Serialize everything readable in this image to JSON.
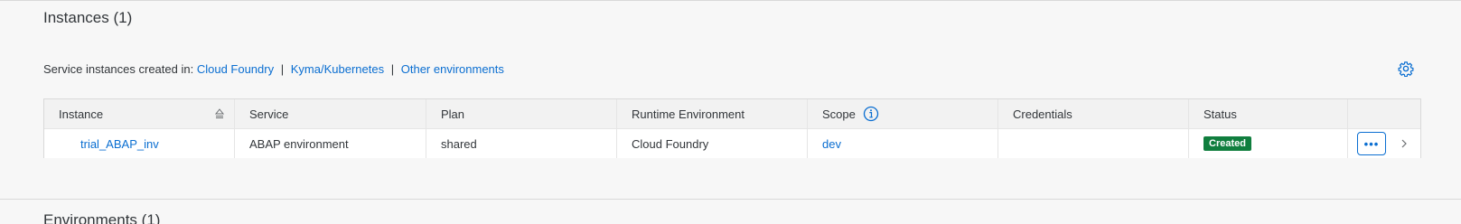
{
  "instances": {
    "title": "Instances (1)",
    "created_in_label": "Service instances created in:",
    "env_links": [
      "Cloud Foundry",
      "Kyma/Kubernetes",
      "Other environments"
    ],
    "separator": "|",
    "settings_icon": "gear-icon",
    "table": {
      "headers": [
        "Instance",
        "Service",
        "Plan",
        "Runtime Environment",
        "Scope",
        "Credentials",
        "Status",
        ""
      ],
      "rows": [
        {
          "instance": "trial_ABAP_inv",
          "service": "ABAP environment",
          "plan": "shared",
          "runtime": "Cloud Foundry",
          "scope": "dev",
          "credentials": "",
          "status": "Created",
          "actions_label": "•••"
        }
      ]
    }
  },
  "environments": {
    "title": "Environments (1)"
  },
  "colors": {
    "link": "#0a6ed1",
    "status_created": "#107e3e",
    "background": "#f7f7f7"
  }
}
